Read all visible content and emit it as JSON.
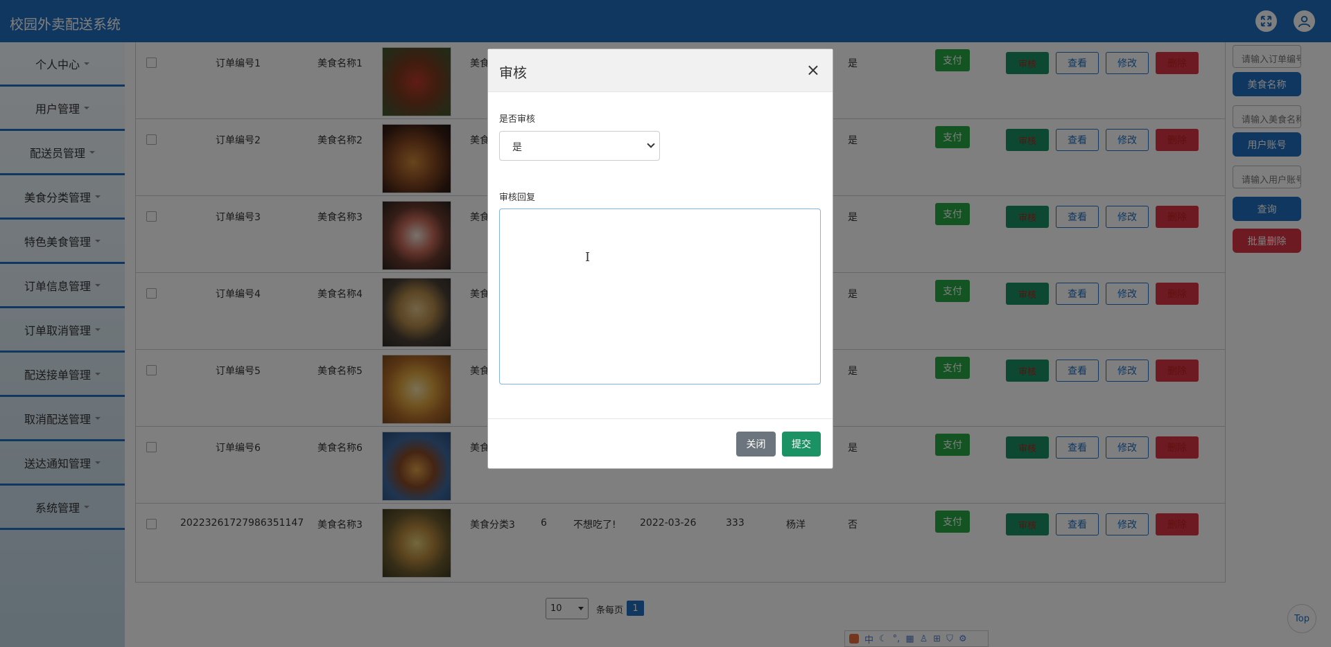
{
  "app": {
    "title": "校园外卖配送系统"
  },
  "sidebar": {
    "items": [
      {
        "label": "个人中心"
      },
      {
        "label": "用户管理"
      },
      {
        "label": "配送员管理"
      },
      {
        "label": "美食分类管理"
      },
      {
        "label": "特色美食管理"
      },
      {
        "label": "订单信息管理"
      },
      {
        "label": "订单取消管理"
      },
      {
        "label": "配送接单管理"
      },
      {
        "label": "取消配送管理"
      },
      {
        "label": "送达通知管理"
      },
      {
        "label": "系统管理"
      }
    ]
  },
  "table": {
    "rows": [
      {
        "order_no": "订单编号1",
        "food_name": "美食名称1",
        "category": "美食",
        "approved": "是"
      },
      {
        "order_no": "订单编号2",
        "food_name": "美食名称2",
        "category": "美食",
        "approved": "是"
      },
      {
        "order_no": "订单编号3",
        "food_name": "美食名称3",
        "category": "美食",
        "approved": "是"
      },
      {
        "order_no": "订单编号4",
        "food_name": "美食名称4",
        "category": "美食",
        "approved": "是"
      },
      {
        "order_no": "订单编号5",
        "food_name": "美食名称5",
        "category": "美食",
        "approved": "是"
      },
      {
        "order_no": "订单编号6",
        "food_name": "美食名称6",
        "category": "美食",
        "approved": "是"
      },
      {
        "order_no": "20223261727986351147",
        "food_name": "美食名称3",
        "category": "美食分类3",
        "qty": "6",
        "reason": "不想吃了!",
        "date": "2022-03-26",
        "amount": "333",
        "user": "杨洋",
        "approved": "否"
      }
    ],
    "buttons": {
      "pay": "支付",
      "audit": "审核",
      "view": "查看",
      "edit": "修改",
      "delete": "删除"
    }
  },
  "search": {
    "order_placeholder": "请输入订单编号",
    "food_button": "美食名称",
    "food_placeholder": "请输入美食名称",
    "user_button": "用户账号",
    "user_placeholder": "请输入用户账号",
    "query_button": "查询",
    "batch_delete_button": "批量删除"
  },
  "pagination": {
    "page_size": "10",
    "per_page_label": "条每页",
    "current_page": "1"
  },
  "modal": {
    "title": "审核",
    "close_symbol": "×",
    "field_approve_label": "是否审核",
    "field_approve_value": "是",
    "field_reply_label": "审核回复",
    "field_reply_value": "",
    "close_button": "关闭",
    "submit_button": "提交"
  },
  "ime": {
    "text": "中"
  },
  "back_to_top": "Top",
  "colors": {
    "primary": "#1e6fc0",
    "success": "#28a745",
    "danger": "#dc3545",
    "teal": "#1a9264"
  }
}
